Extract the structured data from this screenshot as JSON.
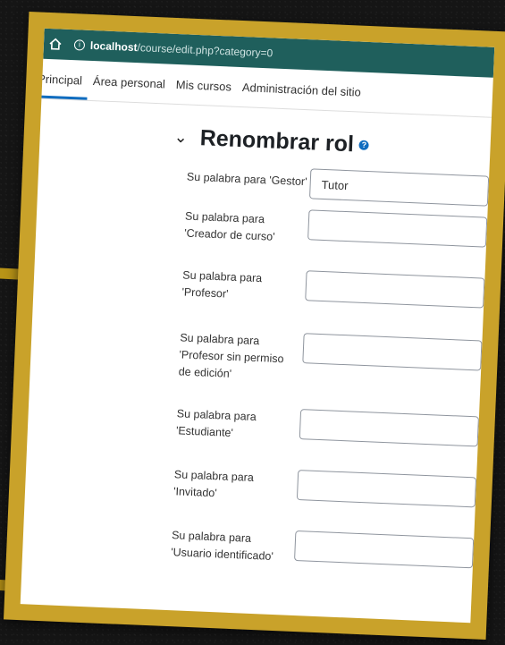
{
  "browser": {
    "url_host": "localhost",
    "url_path": "/course/edit.php?category=0"
  },
  "nav": {
    "items": [
      {
        "label": "a Principal"
      },
      {
        "label": "Área personal"
      },
      {
        "label": "Mis cursos"
      },
      {
        "label": "Administración del sitio"
      }
    ]
  },
  "section": {
    "title": "Renombrar rol"
  },
  "fields": [
    {
      "label": "Su palabra para 'Gestor'",
      "value": "Tutor"
    },
    {
      "label": "Su palabra para 'Creador de curso'",
      "value": ""
    },
    {
      "label": "Su palabra para 'Profesor'",
      "value": ""
    },
    {
      "label": "Su palabra para 'Profesor sin permiso de edición'",
      "value": ""
    },
    {
      "label": "Su palabra para 'Estudiante'",
      "value": ""
    },
    {
      "label": "Su palabra para 'Invitado'",
      "value": ""
    },
    {
      "label": "Su palabra para 'Usuario identificado'",
      "value": ""
    }
  ],
  "colors": {
    "frame": "#c9a22a",
    "browser_bar": "#1f5f5c",
    "accent": "#0f6cbf"
  }
}
